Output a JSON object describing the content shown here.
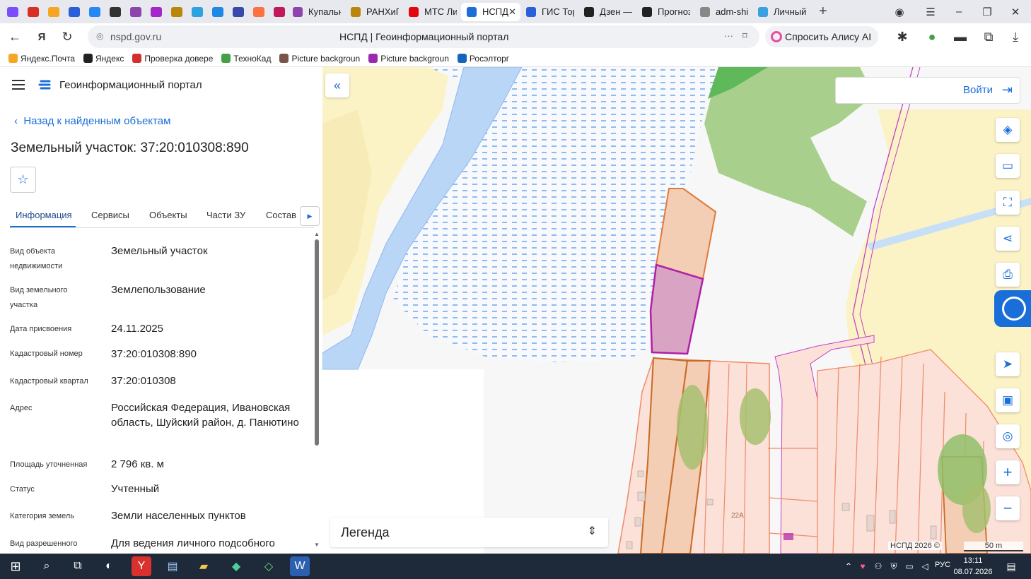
{
  "browser": {
    "pinned_tabs": [
      {
        "icon": "yandex-games-icon",
        "color": "#7b4dff"
      },
      {
        "icon": "gmail-icon",
        "color": "#d93025"
      },
      {
        "icon": "mail-icon",
        "color": "#f5a623"
      },
      {
        "icon": "flag-icon",
        "color": "#2b5fd9"
      },
      {
        "icon": "vk-icon",
        "color": "#2787f5"
      },
      {
        "icon": "sound-icon",
        "color": "#333333"
      },
      {
        "icon": "messenger-icon",
        "color": "#8e44ad"
      },
      {
        "icon": "wildberries-icon",
        "color": "#a327c9"
      },
      {
        "icon": "emblem-icon",
        "color": "#b8860b"
      },
      {
        "icon": "telegram-icon",
        "color": "#2aa3e0"
      },
      {
        "icon": "t-icon",
        "color": "#1e88e5"
      },
      {
        "icon": "u-icon",
        "color": "#3949ab"
      },
      {
        "icon": "hand-icon",
        "color": "#ff7043"
      },
      {
        "icon": "pinterest-icon",
        "color": "#c2185b"
      }
    ],
    "tabs": [
      {
        "label": "Купальн",
        "color": "#8e44ad"
      },
      {
        "label": "РАНХиГ",
        "color": "#b8860b"
      },
      {
        "label": "МТС Ли",
        "color": "#e30611"
      },
      {
        "label": "НСПД",
        "color": "#1a6ed8",
        "active": true
      },
      {
        "label": "ГИС Тор",
        "color": "#2b5fd9"
      },
      {
        "label": "Дзен —",
        "color": "#222222"
      },
      {
        "label": "Прогноз",
        "color": "#222222"
      },
      {
        "label": "adm-shi",
        "color": "#888888"
      },
      {
        "label": "Личный",
        "color": "#3aa0e0"
      }
    ],
    "url": "nspd.gov.ru",
    "page_title": "НСПД | Геоинформационный портал",
    "alisa_label": "Спросить Алису AI",
    "bookmarks": [
      {
        "label": "Яндекс.Почта",
        "color": "#f5a623"
      },
      {
        "label": "Яндекс",
        "color": "#222222"
      },
      {
        "label": "Проверка довере",
        "color": "#d32f2f"
      },
      {
        "label": "ТехноКад",
        "color": "#43a047"
      },
      {
        "label": "Picture backgroun",
        "color": "#795548"
      },
      {
        "label": "Picture backgroun",
        "color": "#9c27b0"
      },
      {
        "label": "Росэлторг",
        "color": "#1565c0"
      }
    ]
  },
  "sidebar": {
    "portal_name": "Геоинформационный портал",
    "back_link": "Назад к найденным объектам",
    "title": "Земельный участок: 37:20:010308:890",
    "tabs": [
      "Информация",
      "Сервисы",
      "Объекты",
      "Части ЗУ",
      "Состав"
    ],
    "fields": [
      {
        "label": "Вид объекта недвижимости",
        "value": "Земельный участок"
      },
      {
        "label": "Вид земельного участка",
        "value": "Землепользование"
      },
      {
        "label": "Дата присвоения",
        "value": "24.11.2025"
      },
      {
        "label": "Кадастровый номер",
        "value": "37:20:010308:890"
      },
      {
        "label": "Кадастровый квартал",
        "value": "37:20:010308"
      },
      {
        "label": "Адрес",
        "value": "Российская Федерация, Ивановская область, Шуйский район, д. Панютино"
      },
      {
        "label": "Площадь уточненная",
        "value": "2 796 кв. м"
      },
      {
        "label": "Статус",
        "value": "Учтенный"
      },
      {
        "label": "Категория земель",
        "value": "Земли населенных пунктов"
      },
      {
        "label": "Вид разрешенного",
        "value": "Для ведения личного подсобного"
      }
    ]
  },
  "map": {
    "login_label": "Войти",
    "legend_label": "Легенда",
    "copyright": "НСПД 2026 ©",
    "scale_label": "50 m",
    "house_number": "22А",
    "colors": {
      "water": "#b9d6f7",
      "marsh_dash": "#4d8fe8",
      "forest": "#a9cf8c",
      "sand": "#fbf3c6",
      "parcel_fill": "#fbe1d8",
      "parcel_stroke": "#f08a6a",
      "selected_fill": "#d9a3c4",
      "selected_stroke": "#b01fa8"
    }
  },
  "taskbar": {
    "time": "13:11",
    "date": "08.07.2026",
    "lang": "РУС"
  }
}
